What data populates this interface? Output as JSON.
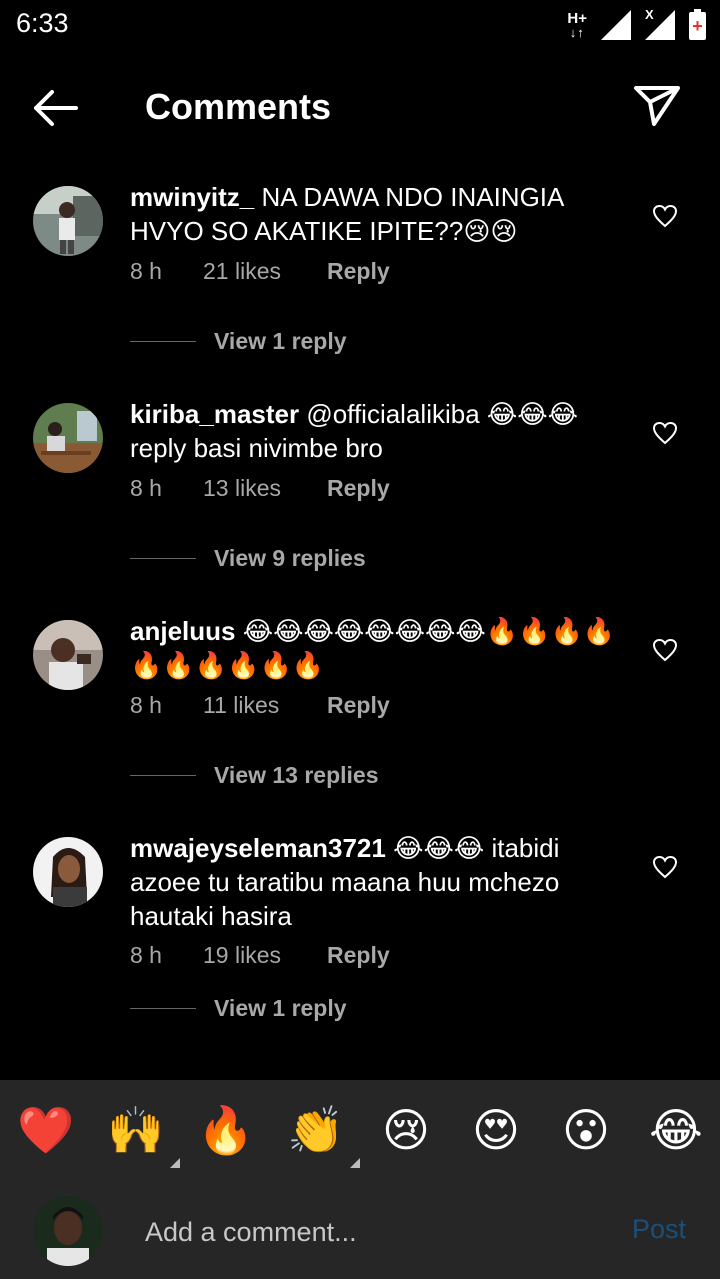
{
  "status_bar": {
    "time": "6:33",
    "network_type": "H+",
    "network_arrows": "↓↑"
  },
  "header": {
    "title": "Comments",
    "back_icon": "arrow-left-icon",
    "send_icon": "paper-plane-icon"
  },
  "comments": [
    {
      "username": "mwinyitz_",
      "text": " NA DAWA NDO INAINGIA HVYO SO AKATIKE IPITE??",
      "emojis": "😢😢",
      "time": "8 h",
      "likes": "21 likes",
      "reply": "Reply",
      "view_replies": "View 1 reply"
    },
    {
      "username": "kiriba_master",
      "text": " @officialalikiba ",
      "emojis": "😂😂😂",
      "text_after": " reply basi nivimbe bro",
      "time": "8 h",
      "likes": "13 likes",
      "reply": "Reply",
      "view_replies": "View 9 replies"
    },
    {
      "username": "anjeluus",
      "text": " ",
      "emojis": "😂😂😂😂😂😂😂😂🔥🔥🔥🔥🔥🔥🔥🔥🔥🔥",
      "time": "8 h",
      "likes": "11 likes",
      "reply": "Reply",
      "view_replies": "View 13 replies"
    },
    {
      "username": "mwajeyseleman3721",
      "text": " ",
      "emojis": "😂😂😂",
      "text_after": " itabidi azoee tu taratibu maana huu mchezo hautaki hasira",
      "time": "8 h",
      "likes": "19 likes",
      "reply": "Reply",
      "view_replies": "View 1 reply"
    }
  ],
  "reactions": [
    "❤️",
    "🙌",
    "🔥",
    "👏",
    "😢",
    "😍",
    "😮",
    "😂"
  ],
  "composer": {
    "placeholder": "Add a comment...",
    "post_label": "Post"
  },
  "colors": {
    "background": "#000000",
    "bottom_bar": "#262626",
    "muted_text": "#a8a8a8",
    "post_disabled": "#1b4f7a"
  }
}
